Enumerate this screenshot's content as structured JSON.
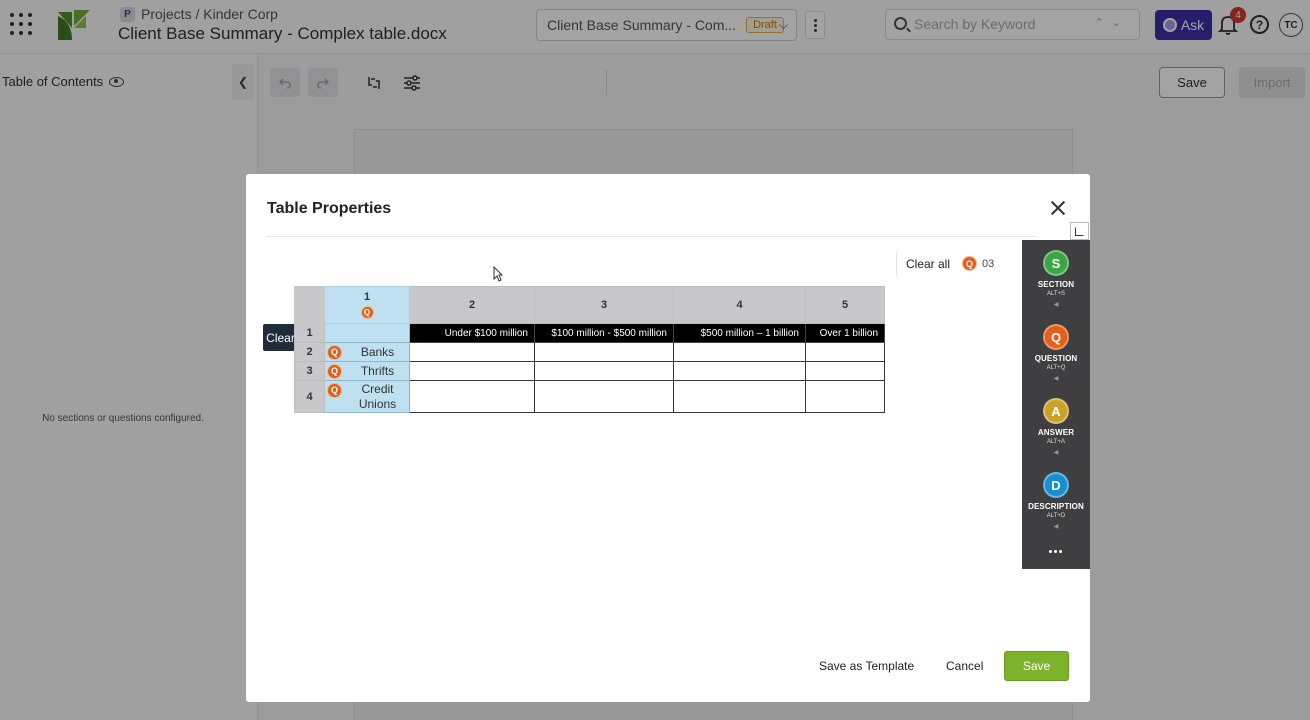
{
  "header": {
    "breadcrumb": "Projects / Kinder Corp",
    "project_icon_letter": "P",
    "doc_title": "Client Base Summary - Complex table.docx",
    "doc_select_value": "Client Base Summary - Com...",
    "draft_badge": "Draft",
    "search_placeholder": "Search by Keyword",
    "ask_label": "Ask",
    "notification_count": "4",
    "avatar_initials": "TC",
    "help_glyph": "?"
  },
  "toolbar": {
    "save_label": "Save",
    "import_label": "Import"
  },
  "sidebar": {
    "title": "Table of Contents",
    "empty_message": "No sections or questions configured."
  },
  "modal": {
    "title": "Table Properties",
    "clear_all_label": "Clear all",
    "question_count": "03",
    "clear_tag": "Clear",
    "footer": {
      "save_as_template": "Save as Template",
      "cancel": "Cancel",
      "save": "Save"
    }
  },
  "table": {
    "col_numbers": [
      "1",
      "2",
      "3",
      "4",
      "5"
    ],
    "row_numbers": [
      "1",
      "2",
      "3",
      "4"
    ],
    "header_row": [
      "Under $100 million",
      "$100 million - $500 million",
      "$500 million – 1 billion",
      "Over 1 billion"
    ],
    "row_labels": [
      "Banks",
      "Thrifts",
      "Credit Unions"
    ],
    "q_letter": "Q"
  },
  "tools": [
    {
      "letter": "S",
      "name": "SECTION",
      "shortcut": "ALT+S",
      "color": "#3aa745"
    },
    {
      "letter": "Q",
      "name": "QUESTION",
      "shortcut": "ALT+Q",
      "color": "#e0601c"
    },
    {
      "letter": "A",
      "name": "ANSWER",
      "shortcut": "ALT+A",
      "color": "#c9a227"
    },
    {
      "letter": "D",
      "name": "DESCRIPTION",
      "shortcut": "ALT+D",
      "color": "#1a8fd0"
    }
  ]
}
